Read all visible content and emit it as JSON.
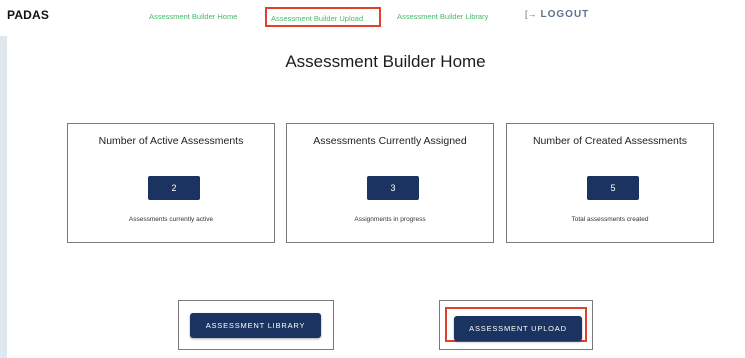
{
  "header": {
    "brand": "PADAS",
    "nav": [
      {
        "label": "Assessment Builder Home"
      },
      {
        "label": "Assessment Builder Upload"
      },
      {
        "label": "Assessment Builder Library"
      }
    ],
    "logout_label": "LOGOUT",
    "logout_icon": "logout-icon"
  },
  "page": {
    "title": "Assessment Builder Home"
  },
  "cards": [
    {
      "title": "Number of Active Assessments",
      "value": "2",
      "caption": "Assessments currently active"
    },
    {
      "title": "Assessments Currently Assigned",
      "value": "3",
      "caption": "Assignments in progress"
    },
    {
      "title": "Number of Created Assessments",
      "value": "5",
      "caption": "Total assessments created"
    }
  ],
  "actions": {
    "library_label": "ASSESSMENT LIBRARY",
    "upload_label": "ASSESSMENT UPLOAD"
  },
  "colors": {
    "accent_link": "#49b86a",
    "primary_button": "#1a3360",
    "highlight_border": "#e0402e",
    "page_background": "#dfe8ef"
  }
}
